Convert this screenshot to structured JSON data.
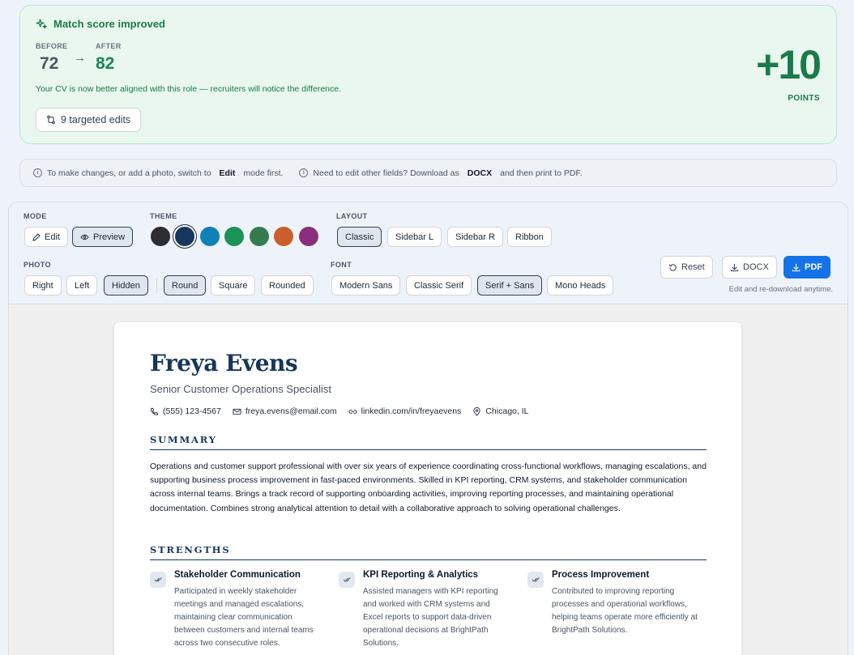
{
  "score": {
    "title": "Match score improved",
    "before_label": "BEFORE",
    "before_value": "72",
    "after_label": "AFTER",
    "after_value": "82",
    "message": "Your CV is now better aligned with this role — recruiters will notice the difference.",
    "edits_label": "9 targeted edits",
    "delta": "+10",
    "delta_label": "POINTS",
    "accent_color": "#1a7a4a"
  },
  "info": {
    "tip1_pre": "To make changes, or add a photo, switch to",
    "tip1_key": "Edit",
    "tip1_post": "mode first.",
    "tip2_pre": "Need to edit other fields? Download as",
    "tip2_key": "DOCX",
    "tip2_post": "and then print to PDF."
  },
  "controls": {
    "mode_label": "MODE",
    "mode_options": [
      "Edit",
      "Preview"
    ],
    "mode_selected": "Preview",
    "theme_label": "THEME",
    "theme_colors": [
      "#2b2d31",
      "#17365d",
      "#0e82b5",
      "#1b9356",
      "#347c4f",
      "#c85f2c",
      "#8b2f7d"
    ],
    "theme_selected": "#17365d",
    "layout_label": "LAYOUT",
    "layout_options": [
      "Classic",
      "Sidebar L",
      "Sidebar R",
      "Ribbon"
    ],
    "layout_selected": "Classic",
    "photo_label": "PHOTO",
    "photo_position_options": [
      "Right",
      "Left",
      "Hidden"
    ],
    "photo_position_selected": "Hidden",
    "photo_shape_options": [
      "Round",
      "Square",
      "Rounded"
    ],
    "photo_shape_selected": "Round",
    "font_label": "FONT",
    "font_options": [
      "Modern Sans",
      "Classic Serif",
      "Serif + Sans",
      "Mono Heads"
    ],
    "font_selected": "Serif + Sans",
    "reset_label": "Reset",
    "docx_label": "DOCX",
    "pdf_label": "PDF",
    "hint": "Edit and re-download anytime.",
    "pdf_color": "#1672e8"
  },
  "resume": {
    "name": "Freya Evens",
    "title": "Senior Customer Operations Specialist",
    "phone": "(555) 123-4567",
    "email": "freya.evens@email.com",
    "linkedin": "linkedin.com/in/freyaevens",
    "location": "Chicago, IL",
    "summary_heading": "SUMMARY",
    "summary": "Operations and customer support professional with over six years of experience coordinating cross-functional workflows, managing escalations, and supporting business process improvement in fast-paced environments. Skilled in KPI reporting, CRM systems, and stakeholder communication across internal teams. Brings a track record of supporting onboarding activities, improving reporting processes, and maintaining operational documentation. Combines strong analytical attention to detail with a collaborative approach to solving operational challenges.",
    "strengths_heading": "STRENGTHS",
    "strengths": [
      {
        "title": "Stakeholder Communication",
        "desc": "Participated in weekly stakeholder meetings and managed escalations, maintaining clear communication between customers and internal teams across two consecutive roles."
      },
      {
        "title": "KPI Reporting & Analytics",
        "desc": "Assisted managers with KPI reporting and worked with CRM systems and Excel reports to support data-driven operational decisions at BrightPath Solutions."
      },
      {
        "title": "Process Improvement",
        "desc": "Contributed to improving reporting processes and operational workflows, helping teams operate more efficiently at BrightPath Solutions."
      }
    ],
    "heading_color": "#17365d"
  }
}
